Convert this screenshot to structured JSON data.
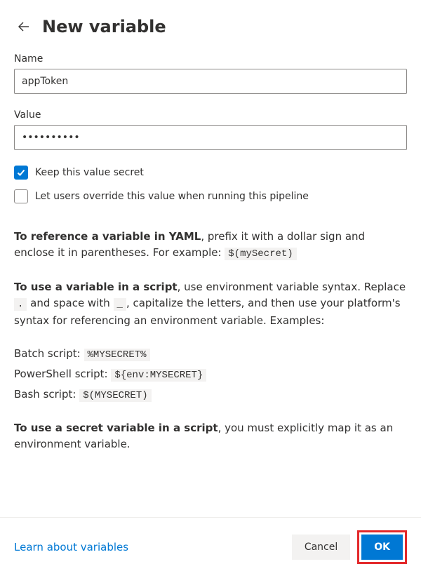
{
  "header": {
    "title": "New variable"
  },
  "form": {
    "name_label": "Name",
    "name_value": "appToken",
    "value_label": "Value",
    "value_value": "••••••••••",
    "keep_secret_label": "Keep this value secret",
    "keep_secret_checked": true,
    "allow_override_label": "Let users override this value when running this pipeline",
    "allow_override_checked": false
  },
  "help": {
    "yaml_intro_bold": "To reference a variable in YAML",
    "yaml_intro_rest": ", prefix it with a dollar sign and enclose it in parentheses. For example: ",
    "yaml_example": "$(mySecret)",
    "script_intro_bold": "To use a variable in a script",
    "script_intro_rest": ", use environment variable syntax. Replace ",
    "dot": ".",
    "script_mid": " and space with ",
    "underscore": "_",
    "script_tail": ", capitalize the letters, and then use your platform's syntax for referencing an environment variable. Examples:",
    "batch_label": "Batch script: ",
    "batch_example": "%MYSECRET%",
    "ps_label": "PowerShell script: ",
    "ps_example": "${env:MYSECRET}",
    "bash_label": "Bash script: ",
    "bash_example": "$(MYSECRET)",
    "secret_intro_bold": "To use a secret variable in a script",
    "secret_intro_rest": ", you must explicitly map it as an environment variable."
  },
  "footer": {
    "learn_link": "Learn about variables",
    "cancel": "Cancel",
    "ok": "OK"
  }
}
